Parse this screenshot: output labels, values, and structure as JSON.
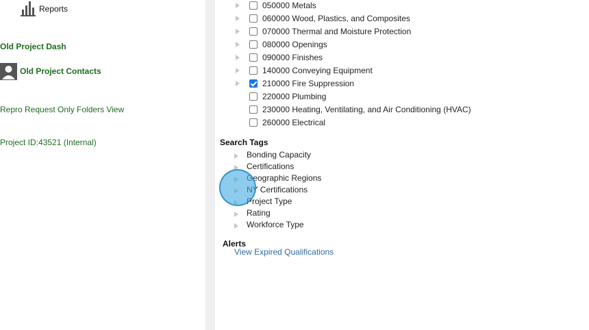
{
  "sidebar": {
    "reports_label": "Reports",
    "old_project_dash": "Old Project Dash",
    "old_project_contacts": "Old Project Contacts",
    "repro_request": "Repro Request Only Folders View",
    "project_id": "Project ID:43521 (Internal)"
  },
  "divisions": [
    {
      "label": "050000 Metals",
      "checked": false,
      "expandable": true
    },
    {
      "label": "060000 Wood, Plastics, and Composites",
      "checked": false,
      "expandable": true
    },
    {
      "label": "070000 Thermal and Moisture Protection",
      "checked": false,
      "expandable": true
    },
    {
      "label": "080000 Openings",
      "checked": false,
      "expandable": true
    },
    {
      "label": "090000 Finishes",
      "checked": false,
      "expandable": true
    },
    {
      "label": "140000 Conveying Equipment",
      "checked": false,
      "expandable": true
    },
    {
      "label": "210000 Fire Suppression",
      "checked": true,
      "expandable": true
    },
    {
      "label": "220000 Plumbing",
      "checked": false,
      "expandable": false
    },
    {
      "label": "230000 Heating, Ventilating, and Air Conditioning (HVAC)",
      "checked": false,
      "expandable": false
    },
    {
      "label": "260000 Electrical",
      "checked": false,
      "expandable": false
    }
  ],
  "search_tags": {
    "heading": "Search Tags",
    "items": [
      "Bonding Capacity",
      "Certifications",
      "Geographic Regions",
      "NY Certifications",
      "Project Type",
      "Rating",
      "Workforce Type"
    ]
  },
  "alerts": {
    "heading": "Alerts",
    "link": "View Expired Qualifications"
  },
  "colors": {
    "sidebar_link": "#1e6b1e",
    "alert_link": "#2d6aa3",
    "checkbox_checked": "#1a73e8",
    "cursor_highlight": "#41aae1"
  }
}
